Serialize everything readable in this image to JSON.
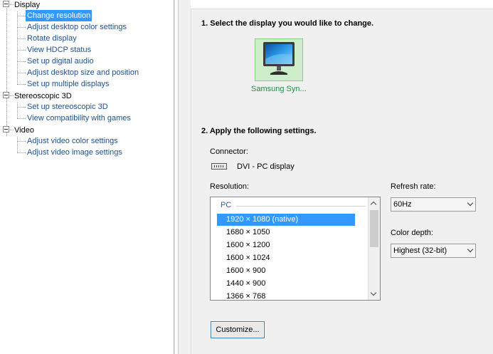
{
  "tree": {
    "groups": [
      {
        "label": "Display",
        "items": [
          "Change resolution",
          "Adjust desktop color settings",
          "Rotate display",
          "View HDCP status",
          "Set up digital audio",
          "Adjust desktop size and position",
          "Set up multiple displays"
        ]
      },
      {
        "label": "Stereoscopic 3D",
        "items": [
          "Set up stereoscopic 3D",
          "View compatibility with games"
        ]
      },
      {
        "label": "Video",
        "items": [
          "Adjust video color settings",
          "Adjust video image settings"
        ]
      }
    ],
    "selected": "Change resolution"
  },
  "main": {
    "step1_heading": "1. Select the display you would like to change.",
    "display_name": "Samsung Syn...",
    "step2_heading": "2. Apply the following settings.",
    "connector_label": "Connector:",
    "connector_value": "DVI - PC display",
    "resolution_label": "Resolution:",
    "resolution_group": "PC",
    "resolutions": [
      "1920 × 1080 (native)",
      "1680 × 1050",
      "1600 × 1200",
      "1600 × 1024",
      "1600 × 900",
      "1440 × 900",
      "1366 × 768"
    ],
    "refresh_label": "Refresh rate:",
    "refresh_value": "60Hz",
    "color_depth_label": "Color depth:",
    "color_depth_value": "Highest (32-bit)",
    "customize_button": "Customize..."
  },
  "icons": {
    "monitor": "monitor-icon",
    "connector": "dvi-connector-icon",
    "collapse": "tree-collapse-icon"
  },
  "colors": {
    "selection": "#3399ff",
    "link": "#1f4f8f",
    "display_tile": "#cdeecb",
    "display_name": "#1e8e3e"
  }
}
